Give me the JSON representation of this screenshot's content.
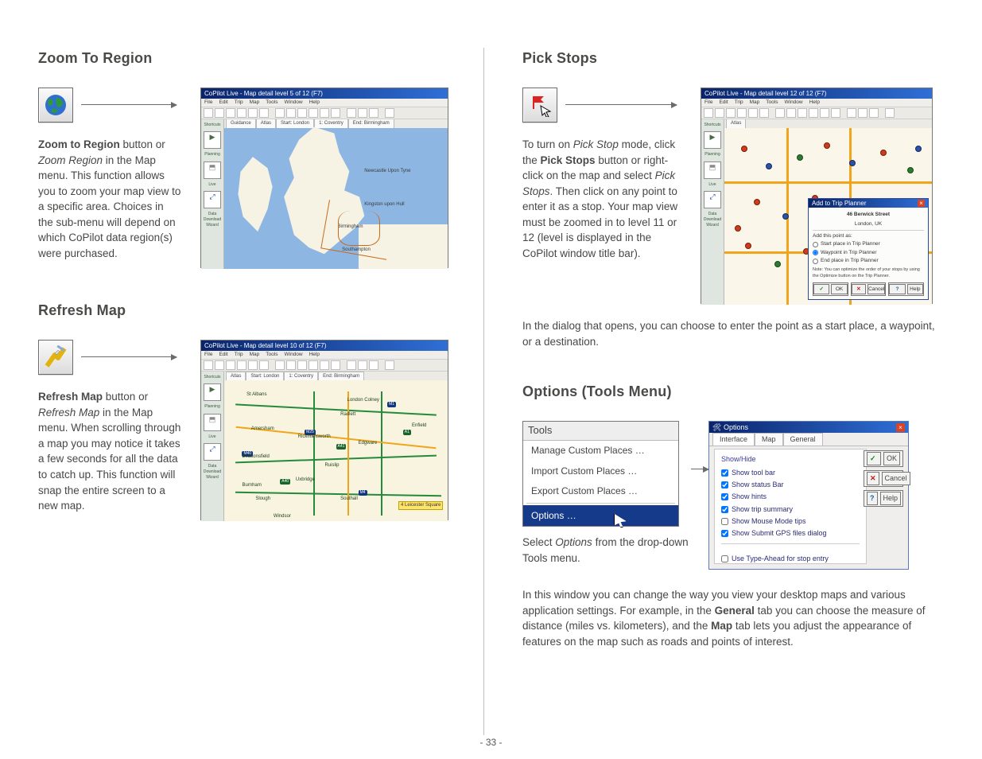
{
  "page_number": "- 33 -",
  "left": {
    "zoom": {
      "title": "Zoom To Region",
      "copy_html": "<b>Zoom to Region</b> button or <i>Zoom Region</i> in the Map menu.  This function allows you to zoom your map view to a specific area.  Choices in the sub-menu will depend on which CoPilot data region(s) were purchased.",
      "shot": {
        "title": "CoPilot Live - Map detail level 5 of 12 (F7)",
        "menubar": [
          "File",
          "Edit",
          "Trip",
          "Map",
          "Tools",
          "Window",
          "Help"
        ],
        "tabs": [
          "Guidance",
          "Atlas",
          "Start: London",
          "1: Coventry",
          "End: Birmingham"
        ],
        "sidebar": [
          "Shortcuts",
          "Planning",
          "Live",
          "Data Download Wizard"
        ],
        "labels": [
          "Newcastle Upon Tyne",
          "Kingston upon Hull",
          "Birmingham",
          "Southampton"
        ]
      }
    },
    "refresh": {
      "title": "Refresh Map",
      "copy_html": "<b>Refresh Map</b> button or <i>Refresh Map</i> in the Map menu.  When scrolling through a map you may notice it takes a few seconds for all the data to catch up.  This function will snap the entire screen to a new map.",
      "shot": {
        "title": "CoPilot Live - Map detail level 10 of 12 (F7)",
        "menubar": [
          "File",
          "Edit",
          "Trip",
          "Map",
          "Tools",
          "Window",
          "Help"
        ],
        "tabs": [
          "Atlas",
          "Start: London",
          "1: Coventry",
          "End: Birmingham"
        ],
        "towns": [
          "St Albans",
          "London Colney",
          "Radlett",
          "Amersham",
          "Rickmansworth",
          "Beaconsfield",
          "Edgware",
          "Ruislip",
          "Burnham",
          "Uxbridge",
          "Slough",
          "Southall",
          "Windsor",
          "Enfield",
          "4 Leicester Square"
        ],
        "shields": [
          "M40",
          "M25",
          "M4",
          "M1",
          "A40",
          "A41",
          "A1"
        ]
      }
    }
  },
  "right": {
    "pick": {
      "title": "Pick Stops",
      "copy_html": "To turn on <i>Pick Stop</i> mode, click the <b>Pick Stops</b> button or right-click on the map and select <i>Pick Stops</i>.  Then click on any point to enter it as a stop.  Your map view must be zoomed in to level 11 or 12 (level is displayed in the CoPilot window title bar).",
      "copy2": "In the dialog that opens, you can choose to enter the point as a start place, a waypoint, or a destination.",
      "shot": {
        "title": "CoPilot Live - Map detail level 12 of 12 (F7)",
        "menubar": [
          "File",
          "Edit",
          "Trip",
          "Map",
          "Tools",
          "Window",
          "Help"
        ],
        "tabs": [
          "Shortcuts",
          "Atlas"
        ],
        "dialog": {
          "title": "Add to Trip Planner",
          "addr1": "46 Berwick Street",
          "addr2": "London, UK",
          "group_label": "Add this point as:",
          "opts": [
            "Start place in Trip Planner",
            "Waypoint in Trip Planner",
            "End place in Trip Planner"
          ],
          "note": "Note: You can optimize the order of your stops by using the Optimize button on the Trip Planner.",
          "ok": "OK",
          "cancel": "Cancel",
          "help": "Help"
        }
      }
    },
    "options": {
      "title": "Options (Tools Menu)",
      "menu": {
        "head": "Tools",
        "items": [
          "Manage Custom Places …",
          "Import Custom Places …",
          "Export Custom Places …"
        ],
        "selected": "Options …"
      },
      "caption_html": "Select <i>Options</i> from the drop-down Tools menu.",
      "dlg": {
        "title": "Options",
        "tabs": [
          "Interface",
          "Map",
          "General"
        ],
        "group1_label": "Show/Hide",
        "group1": [
          "Show tool bar",
          "Show status Bar",
          "Show hints",
          "Show trip summary",
          "Show Mouse Mode tips",
          "Show Submit GPS files dialog"
        ],
        "group1_checked": [
          true,
          true,
          true,
          true,
          false,
          true
        ],
        "group2": [
          "Use Type-Ahead for stop entry"
        ],
        "group2_checked": [
          false
        ],
        "ok": "OK",
        "cancel": "Cancel",
        "help": "Help"
      },
      "copy_html": "In this window you can change the way you view your desktop maps and various application settings.  For example, in the <b>General</b> tab you can choose the measure of distance (miles vs. kilometers), and the <b>Map</b> tab lets you adjust the appearance of features on the map such as roads and points of interest."
    }
  }
}
